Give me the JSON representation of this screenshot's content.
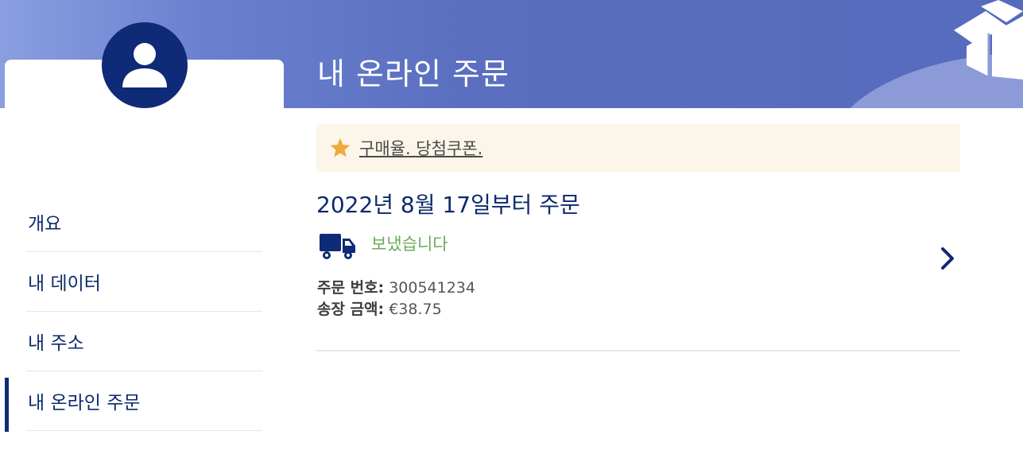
{
  "header": {
    "title": "내 온라인 주문"
  },
  "sidebar": {
    "items": [
      {
        "label": "개요",
        "active": false
      },
      {
        "label": "내 데이터",
        "active": false
      },
      {
        "label": "내 주소",
        "active": false
      },
      {
        "label": "내 온라인 주문",
        "active": true
      }
    ]
  },
  "promo": {
    "icon": "star-icon",
    "text": "구매율. 당첨쿠폰."
  },
  "order": {
    "date_heading": "2022년 8월 17일부터 주문",
    "status_icon": "truck-icon",
    "status": "보냈습니다",
    "number_label": "주문 번호:",
    "number_value": "300541234",
    "amount_label": "송장 금액:",
    "amount_value": "€38.75"
  },
  "colors": {
    "primary": "#0f2a77",
    "banner": "#566bbd",
    "status": "#6aaa5a",
    "promo_bg": "#fcf5ea",
    "star": "#f0a93a"
  }
}
